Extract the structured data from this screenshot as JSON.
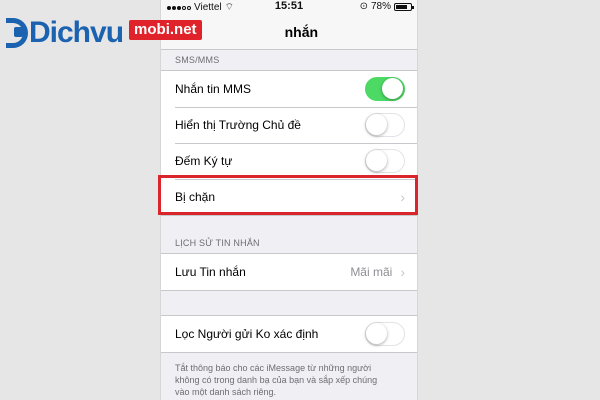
{
  "status_bar": {
    "carrier": "Viettel",
    "time": "15:51",
    "battery": "78%",
    "battery_level": 0.78
  },
  "nav": {
    "title_partial": "nhắn"
  },
  "logo": {
    "word": "Dichvu",
    "badge": "mobi.net"
  },
  "sections": {
    "sms_header": "SMS/MMS",
    "history_header": "LỊCH SỬ TIN NHẮN"
  },
  "rows": {
    "mms": {
      "label": "Nhắn tin MMS",
      "toggle": true
    },
    "subject": {
      "label": "Hiển thị Trường Chủ đề",
      "toggle": false
    },
    "char_count": {
      "label": "Đếm Ký tự",
      "toggle": false
    },
    "blocked": {
      "label": "Bị chặn"
    },
    "keep_messages": {
      "label": "Lưu Tin nhắn",
      "value": "Mãi mãi"
    },
    "filter_unknown": {
      "label": "Lọc Người gửi Ko xác định",
      "toggle": false
    }
  },
  "footer": {
    "line1": "Tắt thông báo cho các iMessage từ những người",
    "line2": "không có trong danh bạ của bạn và sắp xếp chúng",
    "line3": "vào một danh sách riêng."
  },
  "colors": {
    "toggle_on": "#4cd964",
    "highlight": "#d9262c",
    "brand_blue": "#1b62b0",
    "brand_red": "#e0232b"
  }
}
